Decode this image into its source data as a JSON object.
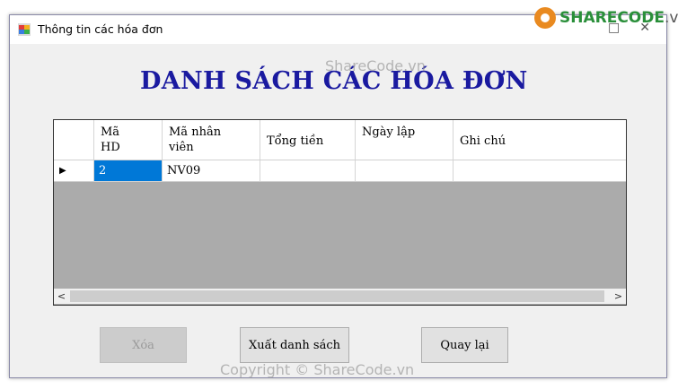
{
  "window": {
    "title": "Thông tin các hóa đơn",
    "controls": [
      "□",
      "✕"
    ]
  },
  "heading": "DANH SÁCH CÁC HÓA ĐƠN",
  "grid": {
    "columns": [
      {
        "line1": "Mã",
        "line2": "HD"
      },
      {
        "line1": "Mã nhân",
        "line2": "viên"
      },
      {
        "line1": "Tổng tiền",
        "line2": ""
      },
      {
        "line1": "Ngày lập",
        "line2": ""
      },
      {
        "line1": "Ghi chú",
        "line2": ""
      }
    ],
    "rows": [
      {
        "ma_hd": "2",
        "ma_nv": "NV09",
        "tong_tien": "",
        "ngay_lap": "",
        "ghi_chu": ""
      }
    ]
  },
  "buttons": {
    "delete": "Xóa",
    "export": "Xuất danh sách",
    "back": "Quay lại"
  },
  "watermarks": {
    "top": "ShareCode.vn",
    "bottom": "Copyright © ShareCode.vn"
  },
  "logo": {
    "brand": "SHARECODE",
    "suffix": ".vn"
  },
  "colors": {
    "heading": "#1a1aa0",
    "selection": "#0078d7",
    "logo_green": "#2a8f3a"
  }
}
